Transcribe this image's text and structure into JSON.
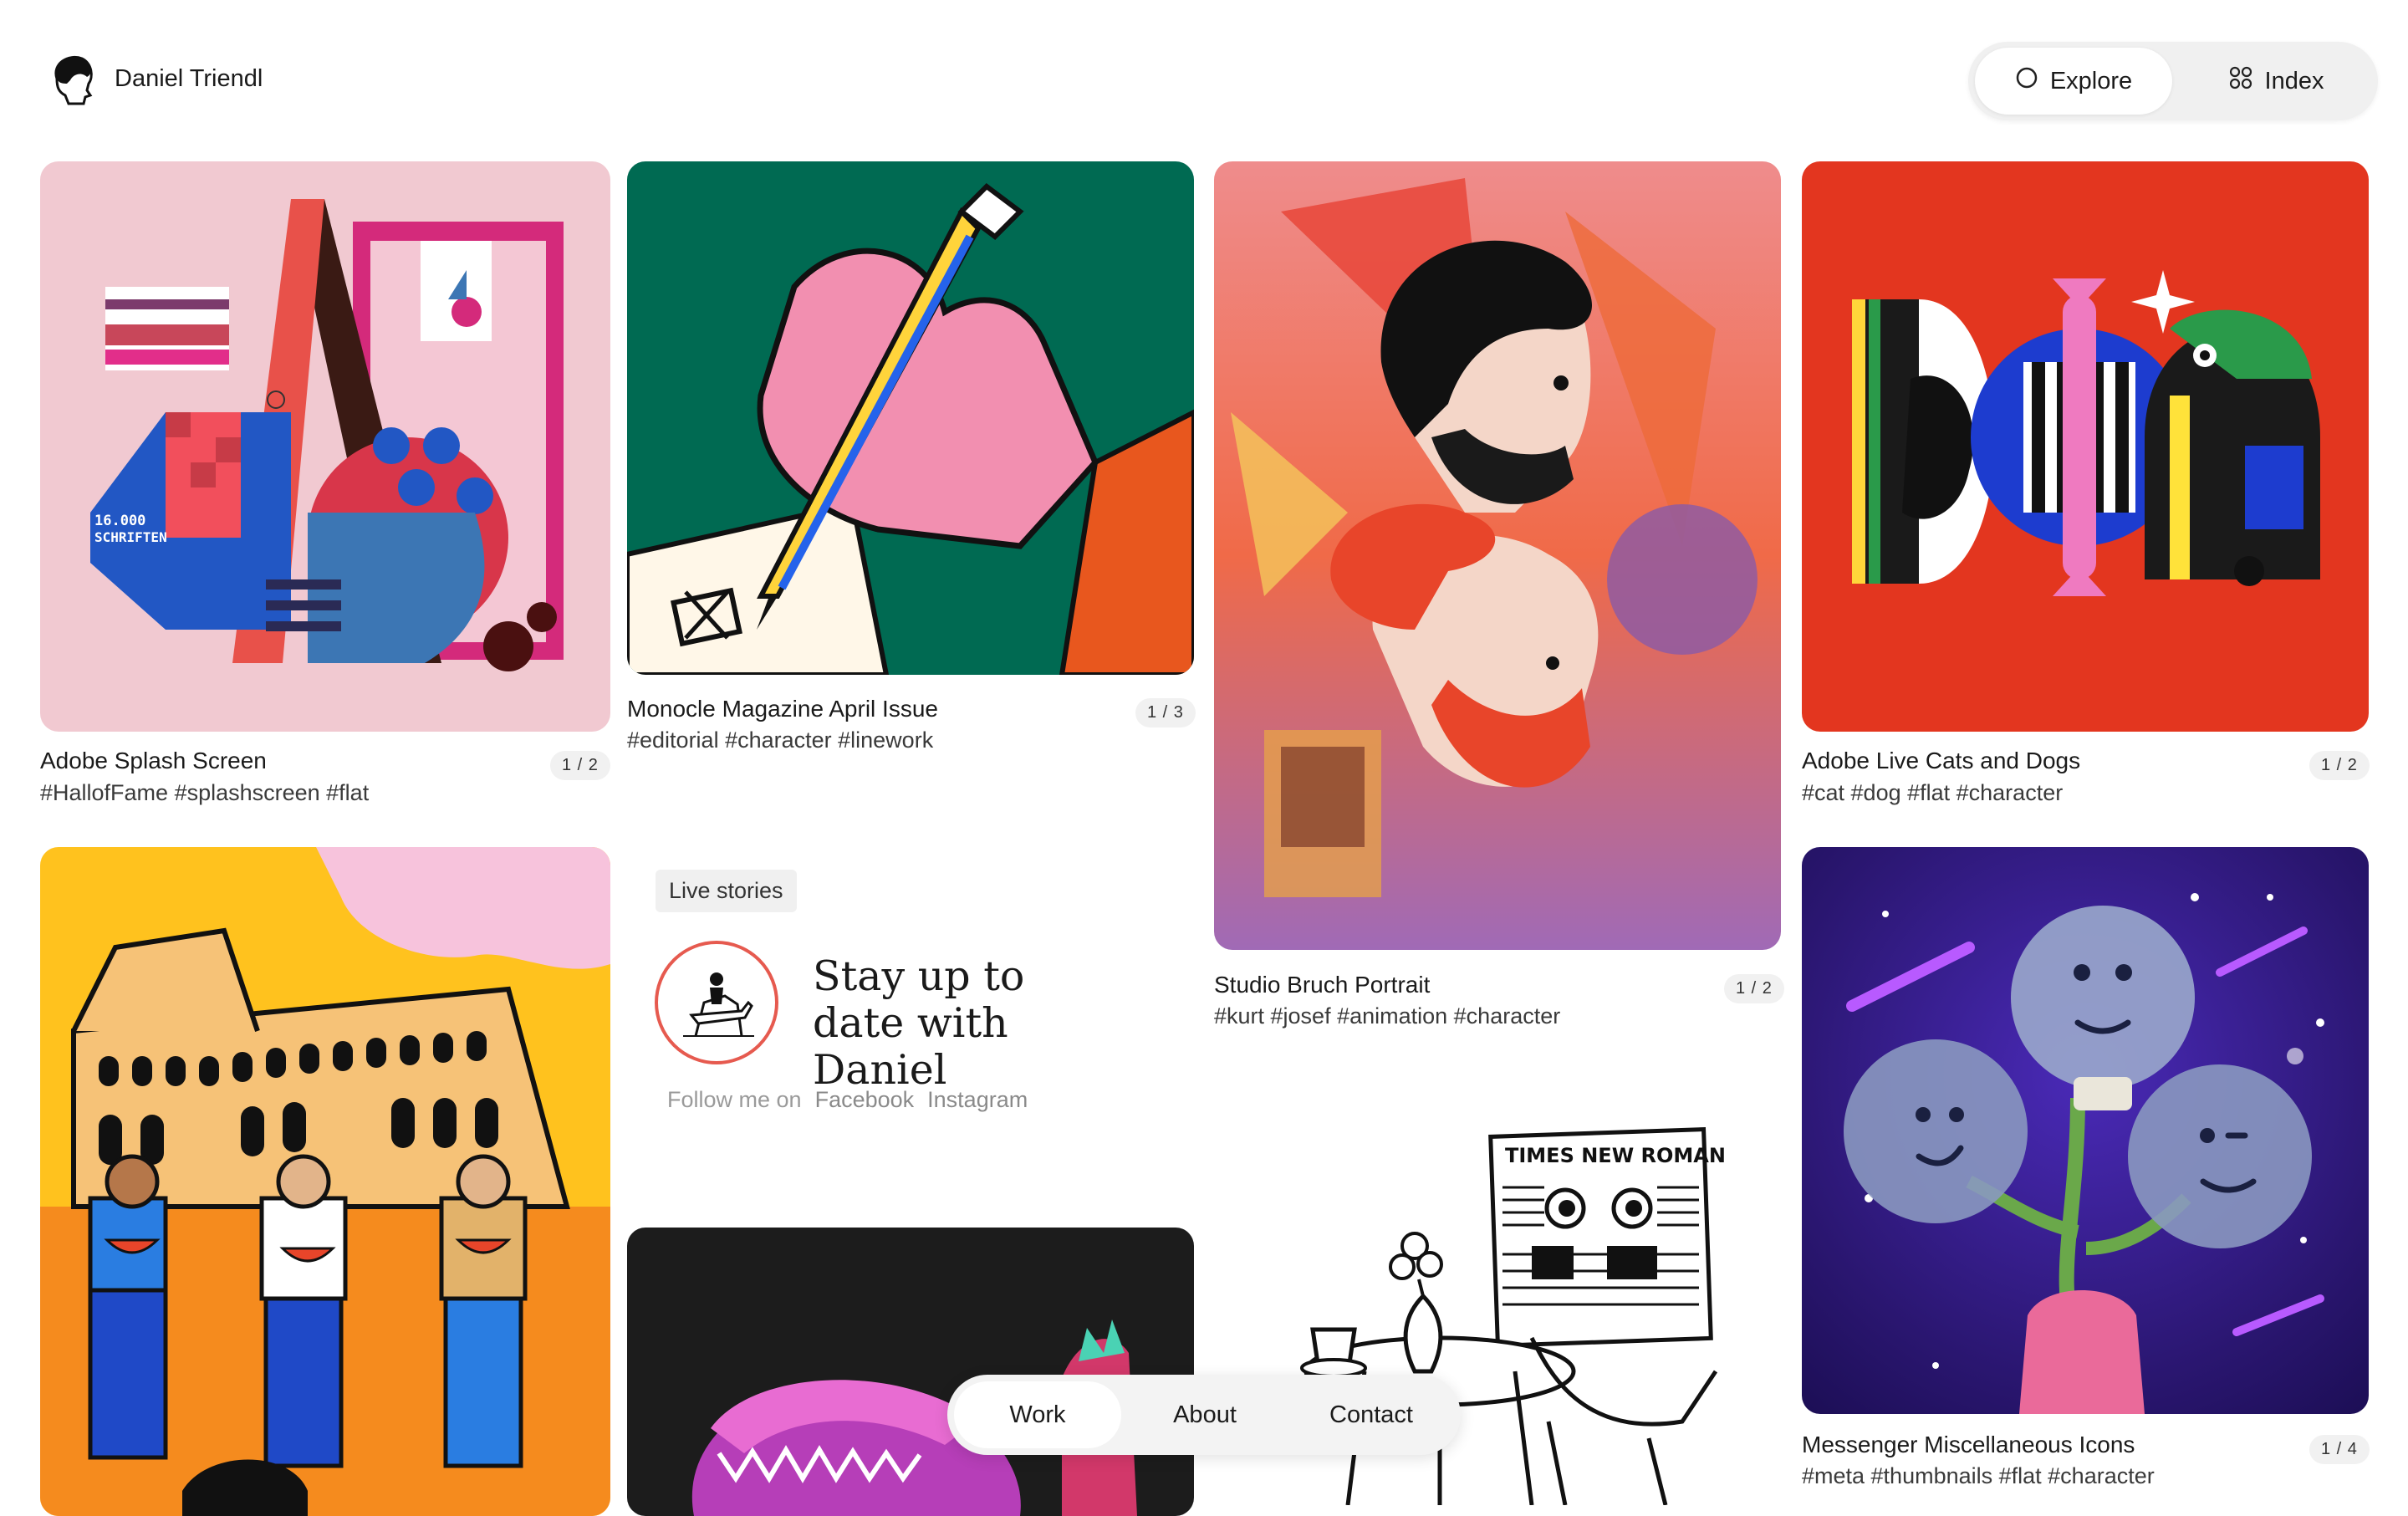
{
  "header": {
    "site_name": "Daniel Triendl",
    "toggle": {
      "explore_label": "Explore",
      "index_label": "Index",
      "active": "Explore"
    }
  },
  "cards": {
    "adobe_splash": {
      "title": "Adobe Splash Screen",
      "tags": "#HallofFame  #splashscreen  #flat",
      "count": "1 / 2",
      "art_text": "16.000",
      "art_text2": "SCHRIFTEN"
    },
    "monocle": {
      "title": "Monocle Magazine April Issue",
      "tags": "#editorial  #character  #linework",
      "count": "1 / 3"
    },
    "studio_bruch": {
      "title": "Studio Bruch Portrait",
      "tags": "#kurt  #josef  #animation  #character",
      "count": "1 / 2"
    },
    "adobe_live": {
      "title": "Adobe Live Cats and Dogs",
      "tags": "#cat  #dog  #flat  #character",
      "count": "1 / 2"
    },
    "messenger": {
      "title": "Messenger Miscellaneous Icons",
      "tags": "#meta  #thumbnails  #flat  #character",
      "count": "1 / 4"
    },
    "newspaper": {
      "art_text": "TIMES NEW ROMAN"
    }
  },
  "live_stories": {
    "badge": "Live stories",
    "title": "Stay up to date with Daniel",
    "follow_label": "Follow me on",
    "facebook": "Facebook",
    "instagram": "Instagram"
  },
  "bottom_nav": {
    "work": "Work",
    "about": "About",
    "contact": "Contact",
    "active": "Work"
  },
  "colors": {
    "accent_ring": "#e65a4f",
    "nav_bg": "#f3f3f3"
  }
}
